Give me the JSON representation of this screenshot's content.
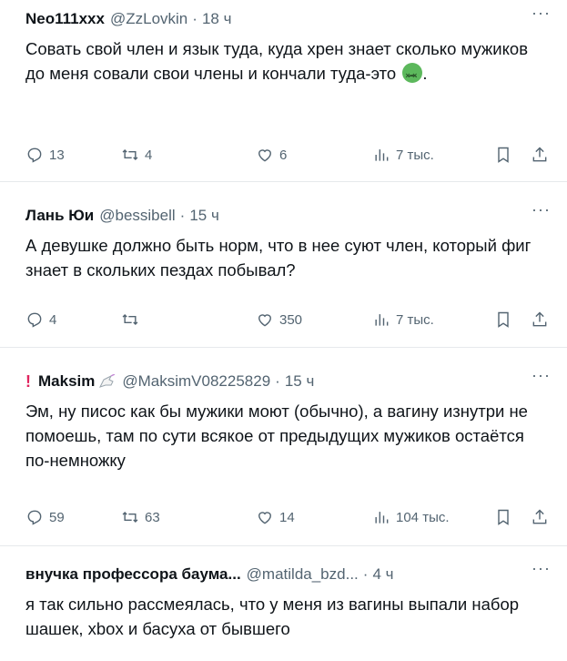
{
  "tweets": [
    {
      "name": "Neo111xxx",
      "handle": "@ZzLovkin",
      "time": "18 ч",
      "more": "···",
      "text": "Совать свой член и язык туда, куда хрен знает сколько мужиков до меня совали свои члены и кончали туда-это",
      "emoji": "nauseated-face",
      "replies": "13",
      "retweets": "4",
      "likes": "6",
      "views": "7 тыс."
    },
    {
      "name": "Лань Юи",
      "handle": "@bessibell",
      "time": "15 ч",
      "more": "···",
      "text": "А девушке должно быть норм, что в нее суют член, который фиг знает в скольких пездах побывал?",
      "replies": "4",
      "retweets": "",
      "likes": "350",
      "views": "7 тыс."
    },
    {
      "prefix": "!",
      "name": "Maksim",
      "badge": "unicorn-badge",
      "handle": "@MaksimV08225829",
      "time": "15 ч",
      "more": "···",
      "text": "Эм, ну писос как бы мужики моют (обычно), а вагину изнутри не помоешь, там по сути всякое от предыдущих мужиков остаётся по-немножку",
      "replies": "59",
      "retweets": "63",
      "likes": "14",
      "views": "104 тыс."
    },
    {
      "name": "внучка профессора баума...",
      "handle": "@matilda_bzd...",
      "time": "4 ч",
      "more": "···",
      "text": "я так сильно рассмеялась, что у меня из вагины выпали набор шашек, xbox и басуха от бывшего"
    }
  ],
  "colors": {
    "text": "#0f1419",
    "muted": "#536471",
    "divider": "#e6e9ec"
  }
}
